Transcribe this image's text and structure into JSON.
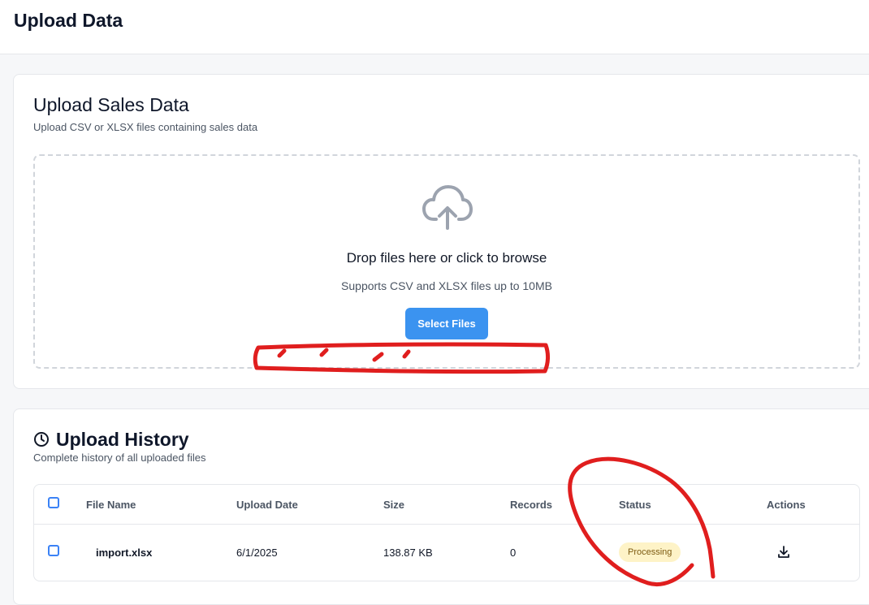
{
  "page": {
    "title": "Upload Data"
  },
  "upload": {
    "title": "Upload Sales Data",
    "subtitle": "Upload CSV or XLSX files containing sales data",
    "drop_title": "Drop files here or click to browse",
    "drop_subtitle": "Supports CSV and XLSX files up to 10MB",
    "button_label": "Select Files",
    "icon": "cloud-upload-icon"
  },
  "history": {
    "title": "Upload History",
    "subtitle": "Complete history of all uploaded files",
    "icon": "clock-icon",
    "columns": [
      "File Name",
      "Upload Date",
      "Size",
      "Records",
      "Status",
      "Actions"
    ],
    "rows": [
      {
        "file_name": "import.xlsx",
        "upload_date": "6/1/2025",
        "size": "138.87 KB",
        "records": "0",
        "status": "Processing"
      }
    ]
  },
  "colors": {
    "accent": "#3b93f0",
    "status_processing_bg": "#fef3c7",
    "annotation": "#e01e1e"
  }
}
